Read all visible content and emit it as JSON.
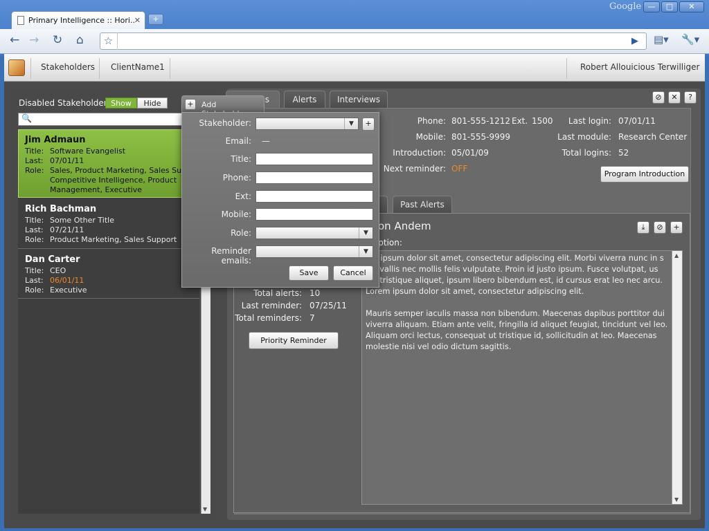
{
  "browser": {
    "tab_title": "Primary Intelligence :: Hori...",
    "tab_close": "✕",
    "newtab": "+",
    "brand": "Google",
    "win_min": "—",
    "win_max": "□",
    "win_close": "✕"
  },
  "app_header": {
    "nav": [
      "Stakeholders",
      "ClientName1"
    ],
    "user_name": "Robert Allouicious Terwilliger"
  },
  "left_panel": {
    "disabled_label": "Disabled Stakeholders:",
    "show_label": "Show",
    "hide_label": "Hide",
    "search_placeholder": "",
    "keys": {
      "title": "Title:",
      "last": "Last:",
      "role": "Role:"
    },
    "stakeholders": [
      {
        "name": "Jim Admaun",
        "title": "Software Evangelist",
        "last": "07/01/11",
        "role_lines": [
          "Sales, Product Marketing, Sales Support,",
          "Competitive Intelligence, Product",
          "Management, Executive"
        ]
      },
      {
        "name": "Rich Bachman",
        "title": "Some Other Title",
        "last": "07/21/11",
        "role_lines": [
          "Product Marketing, Sales Support"
        ]
      },
      {
        "name": "Dan Carter",
        "title": "CEO",
        "last": "06/01/11",
        "role_lines": [
          "Executive"
        ]
      }
    ]
  },
  "right_panel": {
    "tabs": [
      "s",
      "Alerts",
      "Interviews"
    ],
    "details": {
      "phone_label": "Phone:",
      "phone": "801-555-1212",
      "ext_label": "Ext.",
      "ext": "1500",
      "mobile_label": "Mobile:",
      "mobile": "801-555-9999",
      "intro_label": "Introduction:",
      "intro": "05/01/09",
      "next_label": "Next reminder:",
      "next": "OFF",
      "login_label": "Last login:",
      "login": "07/01/11",
      "module_label": "Last module:",
      "module": "Research Center",
      "total_label": "Total logins:",
      "total": "52"
    },
    "program_intro_btn": "Program Introduction",
    "subtabs": [
      "",
      "Past Alerts"
    ],
    "note": {
      "name": "on Andem",
      "desc_label": "ription:",
      "paragraphs": [
        "em ipsum dolor sit amet, consectetur adipiscing elit. Morbi viverra nunc in s convallis nec mollis felis vulputate. Proin id justo ipsum. Fusce volutpat, us vel tristique aliquet, ipsum libero bibendum est, id cursus erat leo nec arcu. Lorem ipsum dolor sit amet, consectetur adipiscing elit.",
        "Mauris semper iaculis massa non bibendum. Maecenas dapibus porttitor dui viverra aliquam. Etiam ante velit, fringilla id aliquet feugiat, tincidunt vel leo. Aliquam orci lectus, consequat ut tristique id, sollicitudin at leo. Maecenas molestie nisi vel odio dictum sagittis."
      ]
    },
    "stats": {
      "alerts_label": "Total alerts:",
      "alerts": "10",
      "last_rem_label": "Last reminder:",
      "last_rem": "07/25/11",
      "total_rem_label": "Total reminders:",
      "total_rem": "7"
    },
    "priority_btn": "Priority Reminder"
  },
  "modal": {
    "title": "Add Stakeholder",
    "stakeholder_label": "Stakeholder:",
    "email_label": "Email:",
    "email_value": "—",
    "title_label": "Title:",
    "phone_label": "Phone:",
    "ext_label": "Ext:",
    "mobile_label": "Mobile:",
    "role_label": "Role:",
    "reminder_label": "Reminder emails:",
    "save": "Save",
    "cancel": "Cancel"
  },
  "colors": {
    "accent_green": "#7fb53a",
    "warn_orange": "#f08a24"
  }
}
